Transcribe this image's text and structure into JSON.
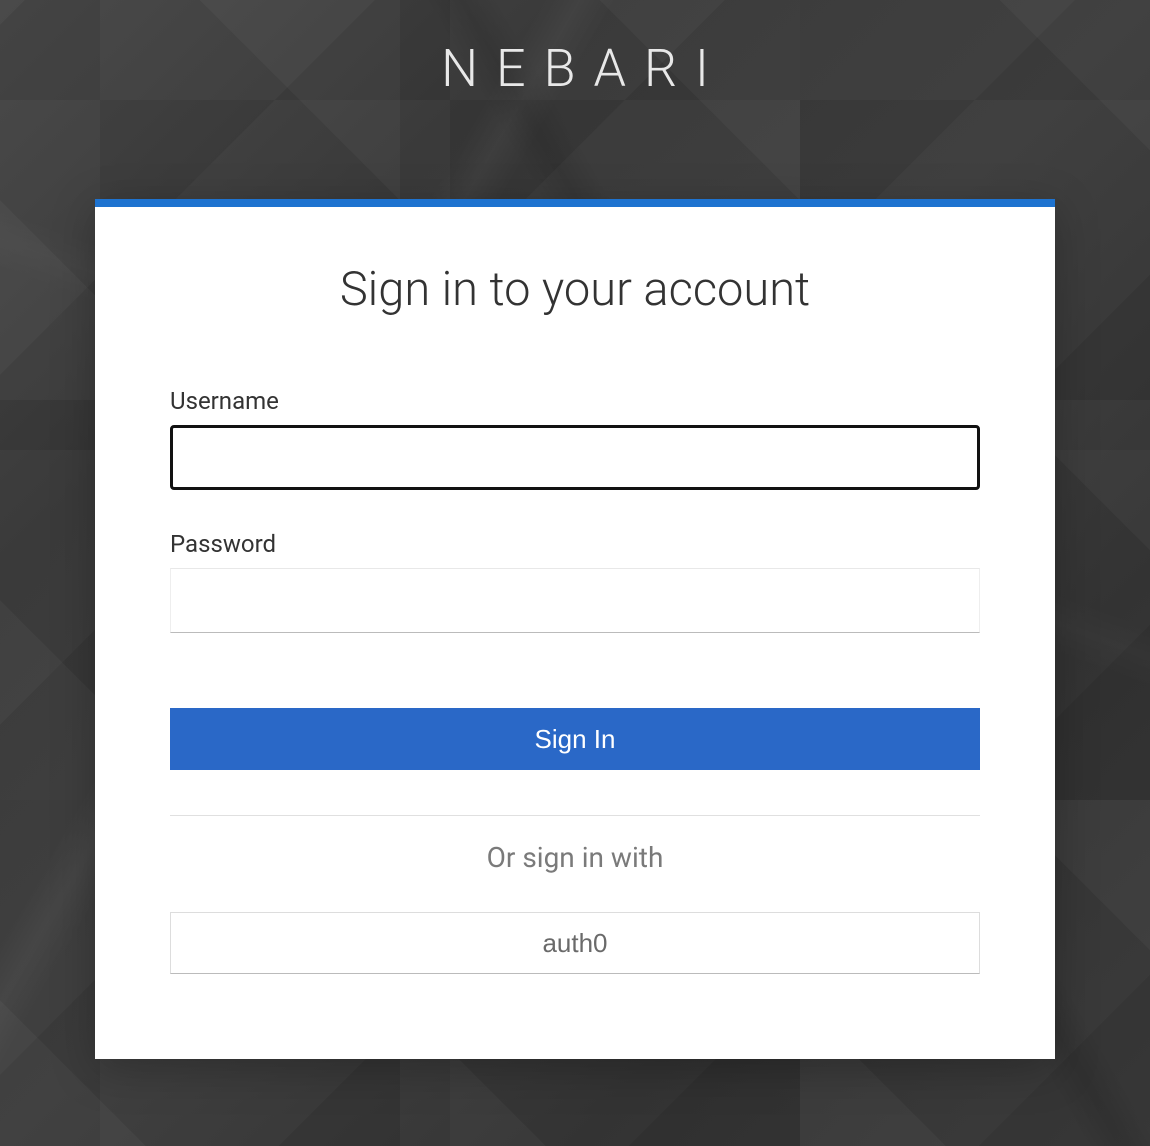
{
  "brand": "NEBARI",
  "card": {
    "title": "Sign in to your account",
    "username": {
      "label": "Username",
      "value": ""
    },
    "password": {
      "label": "Password",
      "value": ""
    },
    "signin_button": "Sign In",
    "divider_text": "Or sign in with",
    "social_provider": "auth0"
  },
  "colors": {
    "accent": "#2a68c7",
    "card_border": "#1e73d0",
    "background": "#3a3a3a"
  }
}
